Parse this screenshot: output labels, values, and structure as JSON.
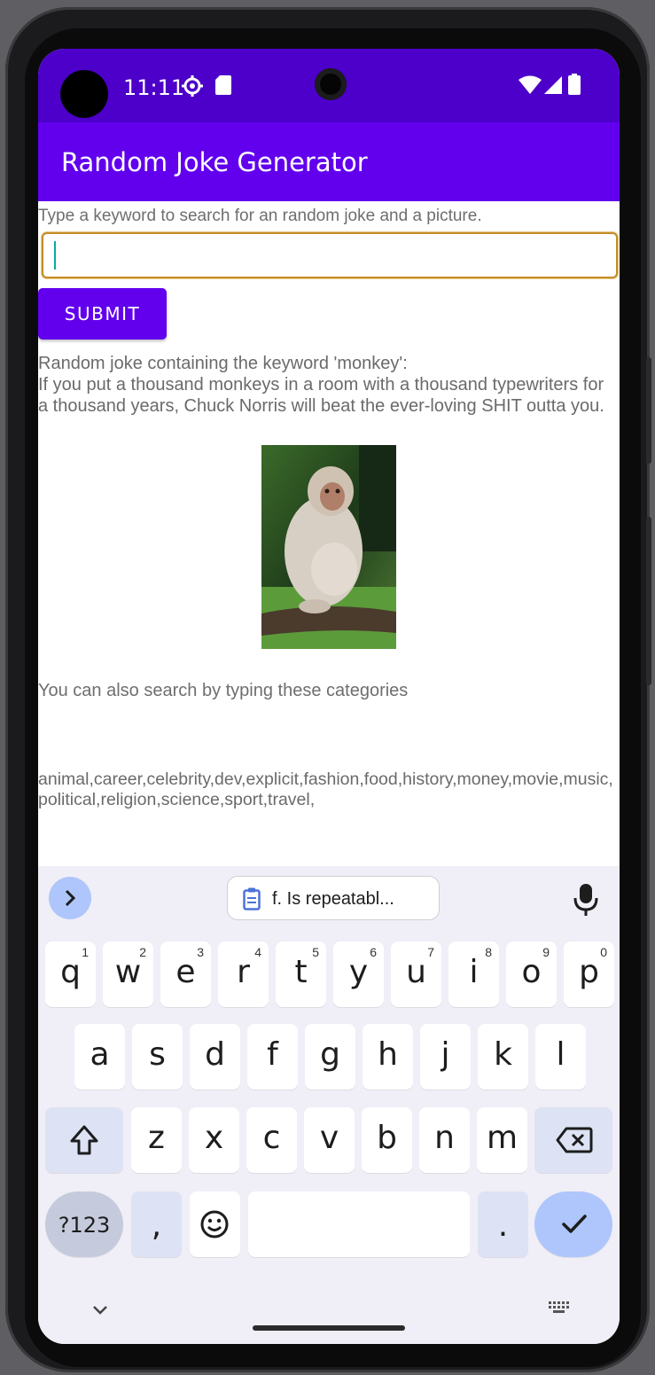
{
  "status": {
    "time": "11:11"
  },
  "app": {
    "title": "Random Joke Generator"
  },
  "search": {
    "prompt": "Type a keyword to search for an random joke and a picture.",
    "value": "",
    "submit_label": "SUBMIT"
  },
  "result": {
    "heading": "Random joke containing the keyword 'monkey':",
    "joke": "If you put a thousand monkeys in a room with a thousand typewriters for a thousand years, Chuck Norris will beat the ever-loving SHIT outta you.",
    "image_subject": "monkey"
  },
  "categories": {
    "intro": "You can also search by typing these categories",
    "list": "animal,career,celebrity,dev,explicit,fashion,food,history,money,movie,music,political,religion,science,sport,travel,"
  },
  "keyboard": {
    "suggestion_chip": "f. Is repeatabl...",
    "row1": [
      {
        "k": "q",
        "n": "1"
      },
      {
        "k": "w",
        "n": "2"
      },
      {
        "k": "e",
        "n": "3"
      },
      {
        "k": "r",
        "n": "4"
      },
      {
        "k": "t",
        "n": "5"
      },
      {
        "k": "y",
        "n": "6"
      },
      {
        "k": "u",
        "n": "7"
      },
      {
        "k": "i",
        "n": "8"
      },
      {
        "k": "o",
        "n": "9"
      },
      {
        "k": "p",
        "n": "0"
      }
    ],
    "row2": [
      "a",
      "s",
      "d",
      "f",
      "g",
      "h",
      "j",
      "k",
      "l"
    ],
    "row3": [
      "z",
      "x",
      "c",
      "v",
      "b",
      "n",
      "m"
    ],
    "symbols_label": "?123",
    "comma": ",",
    "period": "."
  },
  "colors": {
    "status_bar": "#4d00c9",
    "app_bar": "#6200ee",
    "button": "#6200ee",
    "input_border": "#c48d2a"
  },
  "icons": [
    "gear-icon",
    "sd-card-icon",
    "wifi-icon",
    "signal-icon",
    "battery-icon",
    "chevron-right-icon",
    "clipboard-icon",
    "microphone-icon",
    "shift-icon",
    "backspace-icon",
    "emoji-icon",
    "check-icon",
    "chevron-down-icon",
    "keyboard-icon"
  ]
}
